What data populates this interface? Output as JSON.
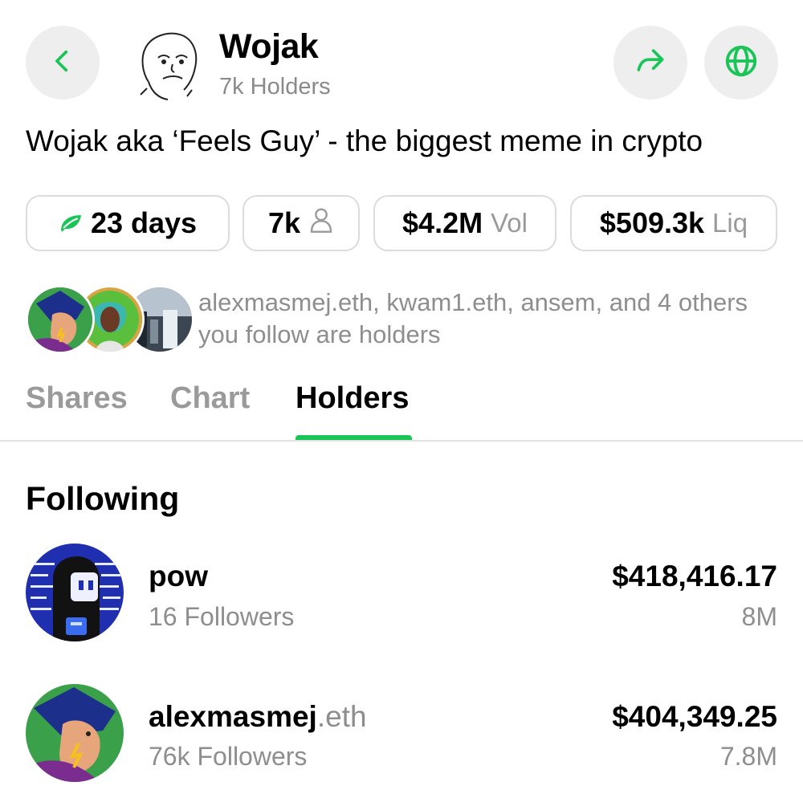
{
  "header": {
    "title": "Wojak",
    "subtitle": "7k Holders",
    "accent": "#19c557"
  },
  "description": "Wojak aka ‘Feels Guy’ - the biggest meme in crypto",
  "stats": {
    "age": "23 days",
    "holders": "7k",
    "volume_value": "$4.2M",
    "volume_unit": "Vol",
    "liquidity_value": "$509.3k",
    "liquidity_unit": "Liq"
  },
  "social_proof": "alexmasmej.eth, kwam1.eth, ansem, and 4 others you follow are holders",
  "tabs": [
    {
      "label": "Shares",
      "active": false
    },
    {
      "label": "Chart",
      "active": false
    },
    {
      "label": "Holders",
      "active": true
    }
  ],
  "section_title": "Following",
  "holders": [
    {
      "name": "pow",
      "suffix": "",
      "followers": "16 Followers",
      "value": "$418,416.17",
      "amount": "8M"
    },
    {
      "name": "alexmasmej",
      "suffix": ".eth",
      "followers": "76k Followers",
      "value": "$404,349.25",
      "amount": "7.8M"
    }
  ]
}
